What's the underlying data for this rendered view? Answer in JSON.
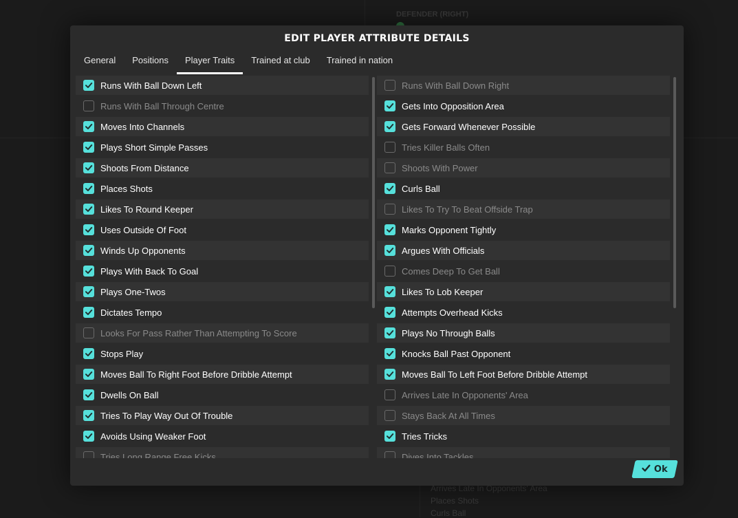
{
  "background": {
    "header_text": "DEFENDER (RIGHT)",
    "list_items": [
      "Arrives Late In Opponents' Area",
      "Places Shots",
      "Curls Ball"
    ]
  },
  "dialog": {
    "title": "EDIT PLAYER ATTRIBUTE DETAILS",
    "tabs": [
      {
        "label": "General",
        "active": false
      },
      {
        "label": "Positions",
        "active": false
      },
      {
        "label": "Player Traits",
        "active": true
      },
      {
        "label": "Trained at club",
        "active": false
      },
      {
        "label": "Trained in nation",
        "active": false
      }
    ],
    "left_traits": [
      {
        "label": "Runs With Ball Down Left",
        "checked": true
      },
      {
        "label": "Runs With Ball Through Centre",
        "checked": false
      },
      {
        "label": "Moves Into Channels",
        "checked": true
      },
      {
        "label": "Plays Short Simple Passes",
        "checked": true
      },
      {
        "label": "Shoots From Distance",
        "checked": true
      },
      {
        "label": "Places Shots",
        "checked": true
      },
      {
        "label": "Likes To Round Keeper",
        "checked": true
      },
      {
        "label": "Uses Outside Of Foot",
        "checked": true
      },
      {
        "label": "Winds Up Opponents",
        "checked": true
      },
      {
        "label": "Plays With Back To Goal",
        "checked": true
      },
      {
        "label": "Plays One-Twos",
        "checked": true
      },
      {
        "label": "Dictates Tempo",
        "checked": true
      },
      {
        "label": "Looks For Pass Rather Than Attempting To Score",
        "checked": false
      },
      {
        "label": "Stops Play",
        "checked": true
      },
      {
        "label": "Moves Ball To Right Foot Before Dribble Attempt",
        "checked": true
      },
      {
        "label": "Dwells On Ball",
        "checked": true
      },
      {
        "label": "Tries To Play Way Out Of Trouble",
        "checked": true
      },
      {
        "label": "Avoids Using Weaker Foot",
        "checked": true
      },
      {
        "label": "Tries Long Range Free Kicks",
        "checked": false
      }
    ],
    "right_traits": [
      {
        "label": "Runs With Ball Down Right",
        "checked": false
      },
      {
        "label": "Gets Into Opposition Area",
        "checked": true
      },
      {
        "label": "Gets Forward Whenever Possible",
        "checked": true
      },
      {
        "label": "Tries Killer Balls Often",
        "checked": false
      },
      {
        "label": "Shoots With Power",
        "checked": false
      },
      {
        "label": "Curls Ball",
        "checked": true
      },
      {
        "label": "Likes To Try To Beat Offside Trap",
        "checked": false
      },
      {
        "label": "Marks Opponent Tightly",
        "checked": true
      },
      {
        "label": "Argues With Officials",
        "checked": true
      },
      {
        "label": "Comes Deep To Get Ball",
        "checked": false
      },
      {
        "label": "Likes To Lob Keeper",
        "checked": true
      },
      {
        "label": "Attempts Overhead Kicks",
        "checked": true
      },
      {
        "label": "Plays No Through Balls",
        "checked": true
      },
      {
        "label": "Knocks Ball Past Opponent",
        "checked": true
      },
      {
        "label": "Moves Ball To Left Foot Before Dribble Attempt",
        "checked": true
      },
      {
        "label": "Arrives Late In Opponents' Area",
        "checked": false
      },
      {
        "label": "Stays Back At All Times",
        "checked": false
      },
      {
        "label": "Tries Tricks",
        "checked": true
      },
      {
        "label": "Dives Into Tackles",
        "checked": false
      }
    ],
    "ok_button": {
      "label": "Ok",
      "icon": "check-icon"
    }
  },
  "colors": {
    "accent": "#56e0db",
    "dialog_bg": "#2b2b2b",
    "row_alt_bg": "#333333"
  }
}
